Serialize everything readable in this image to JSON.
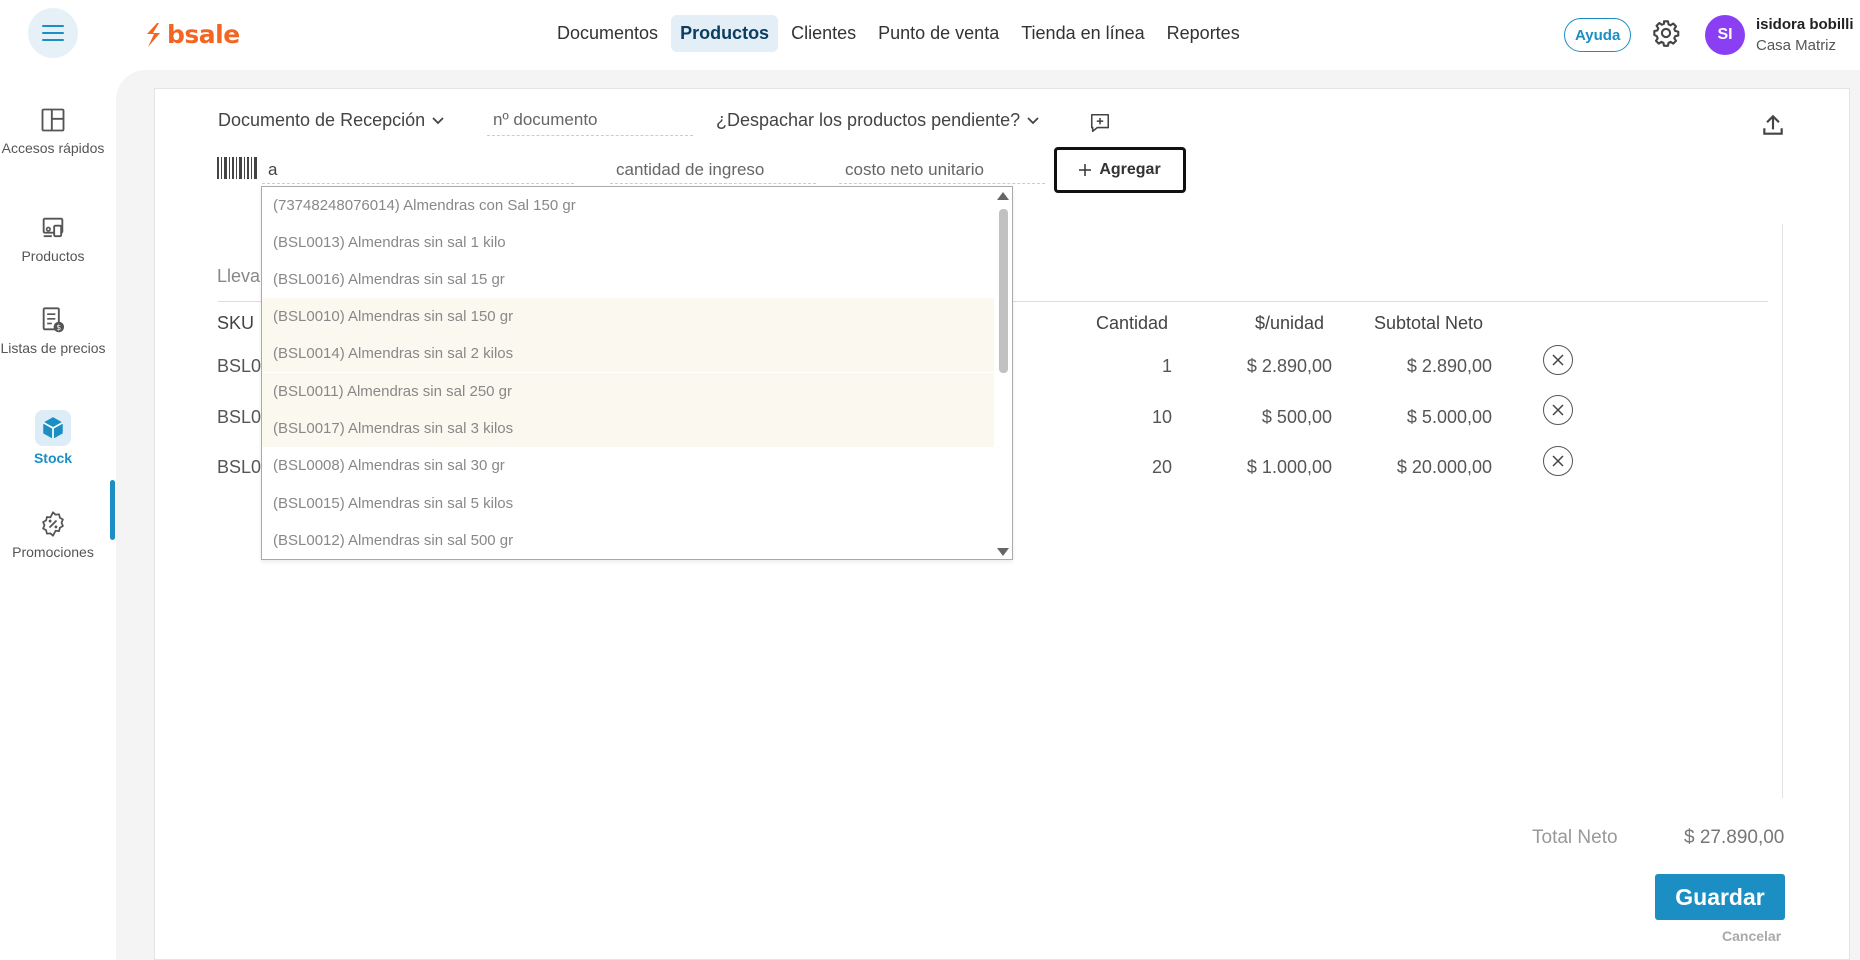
{
  "brand": {
    "name": "bsale",
    "color": "#f26522"
  },
  "nav": {
    "items": [
      "Documentos",
      "Productos",
      "Clientes",
      "Punto de venta",
      "Tienda en línea",
      "Reportes"
    ],
    "active": "Productos"
  },
  "header": {
    "help_label": "Ayuda",
    "avatar_initials": "SI",
    "user_name": "isidora bobilli",
    "user_branch": "Casa Matriz"
  },
  "sidebar": {
    "items": [
      {
        "label": "Accesos rápidos",
        "icon": "layout-icon"
      },
      {
        "label": "Productos",
        "icon": "devices-icon"
      },
      {
        "label": "Listas de precios",
        "icon": "price-list-icon"
      },
      {
        "label": "Stock",
        "icon": "box-icon",
        "active": true
      },
      {
        "label": "Promociones",
        "icon": "promo-gear-icon"
      }
    ]
  },
  "form": {
    "document_type": "Documento de Recepción",
    "doc_number_placeholder": "nº documento",
    "dispatch_question": "¿Despachar los productos pendiente?",
    "search_value": "a",
    "qty_placeholder": "cantidad de ingreso",
    "cost_placeholder": "costo neto unitario",
    "add_button": "Agregar"
  },
  "dropdown": {
    "options": [
      "(73748248076014) Almendras con Sal 150 gr",
      "(BSL0013) Almendras sin sal 1 kilo",
      "(BSL0016) Almendras sin sal 15 gr",
      "(BSL0010) Almendras sin sal 150 gr",
      "(BSL0014) Almendras sin sal 2 kilos",
      "(BSL0011) Almendras sin sal 250 gr",
      "(BSL0017) Almendras sin sal 3 kilos",
      "(BSL0008) Almendras sin sal 30 gr",
      "(BSL0015) Almendras sin sal 5 kilos",
      "(BSL0012) Almendras sin sal 500 gr"
    ]
  },
  "table": {
    "partial_label": "Lleva",
    "headers": {
      "sku": "SKU",
      "qty": "Cantidad",
      "unit": "$/unidad",
      "subtotal": "Subtotal Neto"
    },
    "rows": [
      {
        "sku": "BSL0",
        "qty": "1",
        "unit": "$ 2.890,00",
        "subtotal": "$ 2.890,00"
      },
      {
        "sku": "BSL0",
        "qty": "10",
        "unit": "$ 500,00",
        "subtotal": "$ 5.000,00"
      },
      {
        "sku": "BSL0",
        "qty": "20",
        "unit": "$ 1.000,00",
        "subtotal": "$ 20.000,00"
      }
    ]
  },
  "totals": {
    "label": "Total Neto",
    "value": "$ 27.890,00",
    "save": "Guardar",
    "cancel": "Cancelar"
  },
  "colors": {
    "accent": "#1b8fc4",
    "avatar": "#8a3ff2"
  }
}
